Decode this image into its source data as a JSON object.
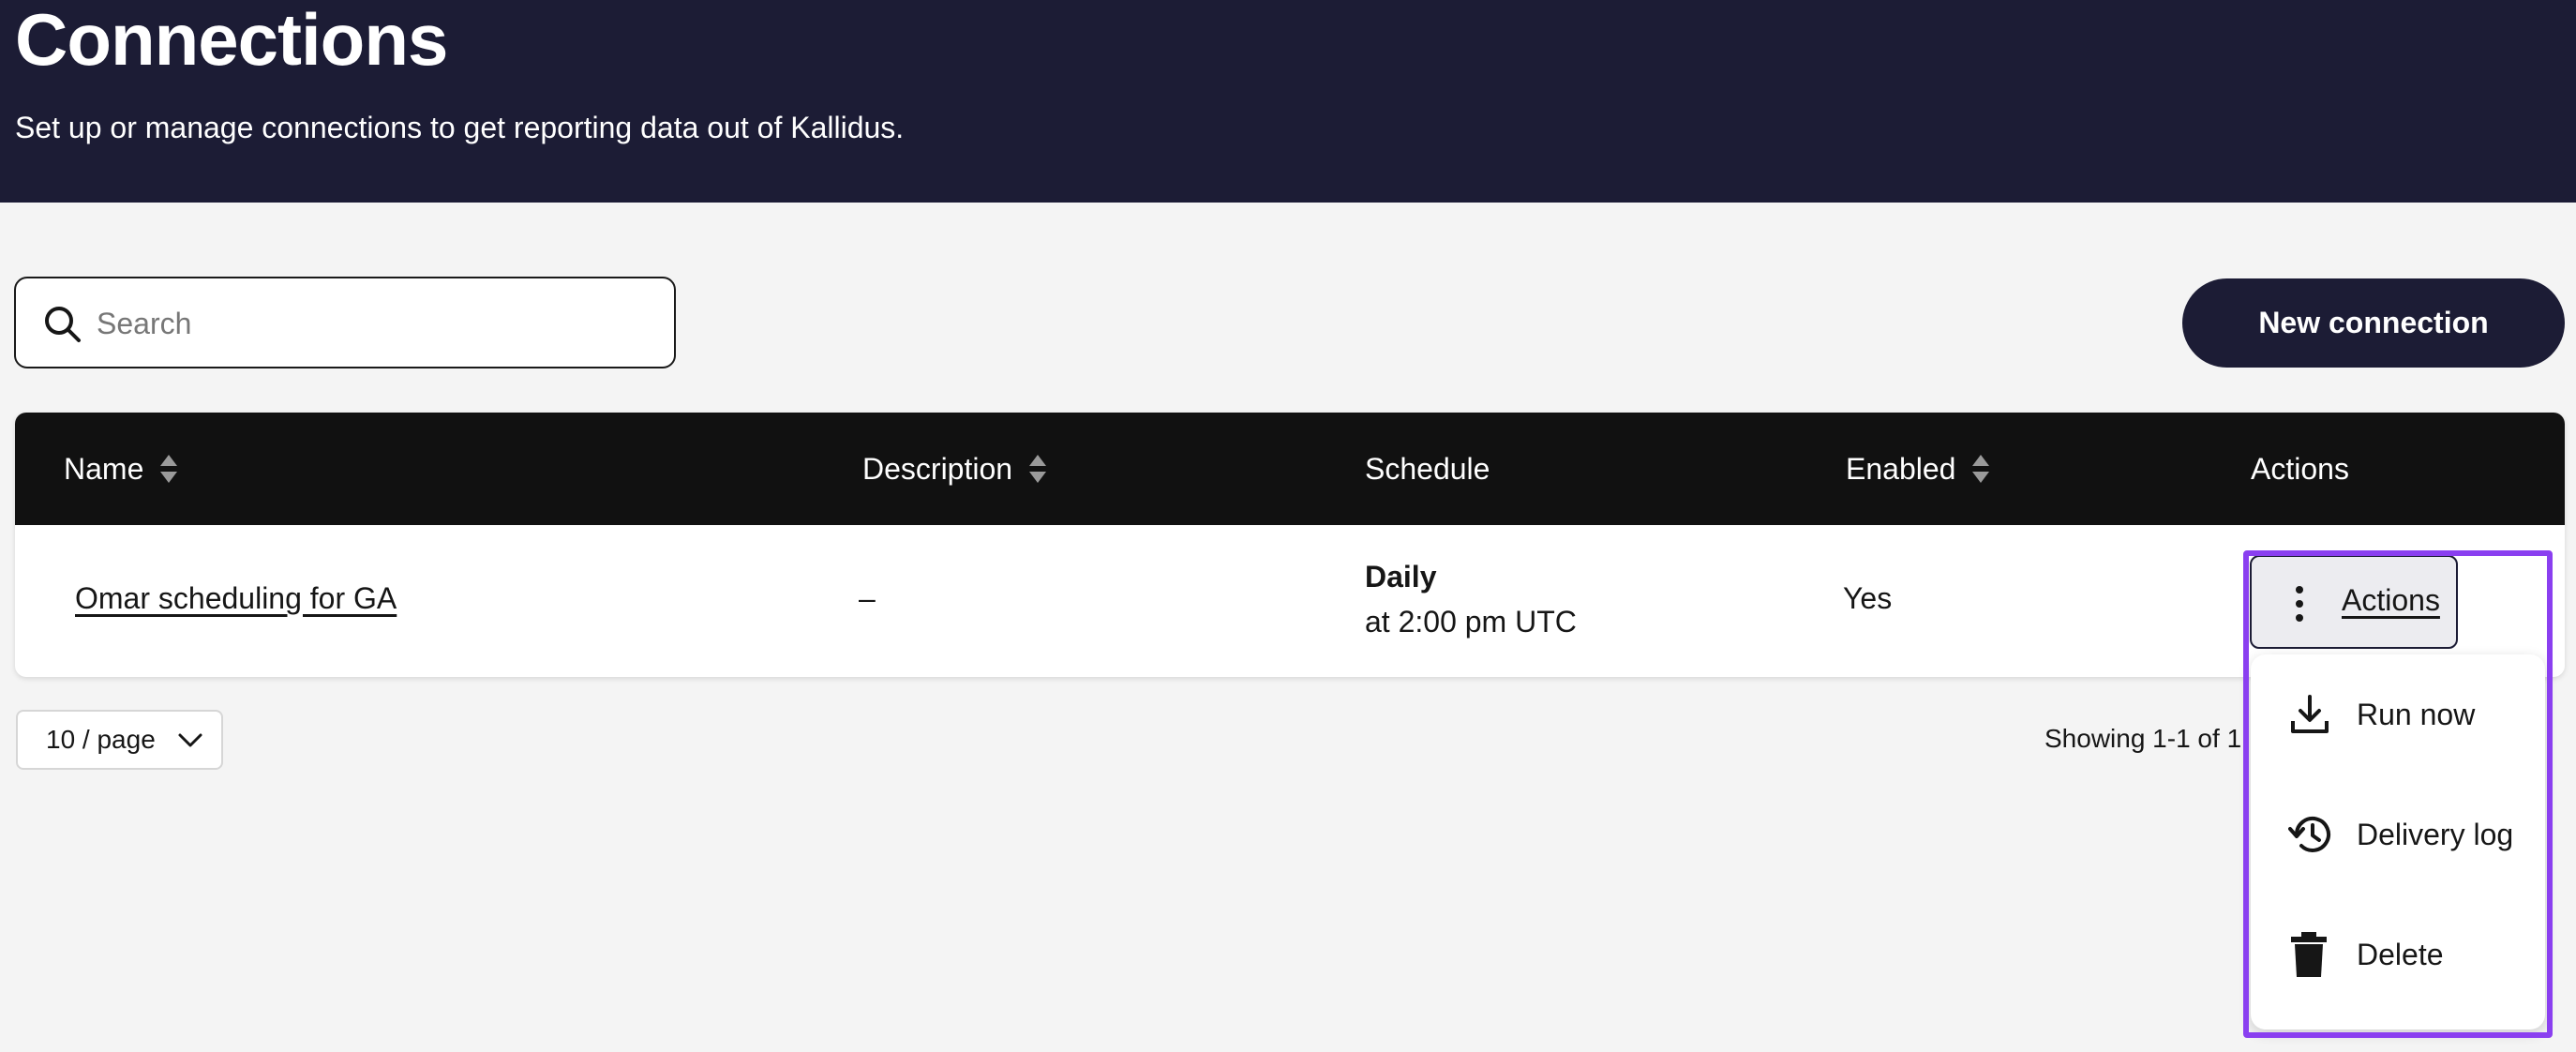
{
  "header": {
    "title": "Connections",
    "subtitle": "Set up or manage connections to get reporting data out of Kallidus."
  },
  "toolbar": {
    "search_placeholder": "Search",
    "search_value": "",
    "new_connection_label": "New connection"
  },
  "table": {
    "columns": [
      {
        "label": "Name",
        "sortable": true
      },
      {
        "label": "Description",
        "sortable": true
      },
      {
        "label": "Schedule",
        "sortable": false
      },
      {
        "label": "Enabled",
        "sortable": true
      },
      {
        "label": "Actions",
        "sortable": false
      }
    ],
    "rows": [
      {
        "name": "Omar scheduling for GA",
        "description": "–",
        "schedule_frequency": "Daily",
        "schedule_time": "at 2:00 pm UTC",
        "enabled": "Yes",
        "actions_label": "Actions"
      }
    ]
  },
  "actions_menu": {
    "items": [
      {
        "label": "Run now",
        "icon": "download-icon"
      },
      {
        "label": "Delivery log",
        "icon": "history-icon"
      },
      {
        "label": "Delete",
        "icon": "trash-icon"
      }
    ]
  },
  "pagination": {
    "page_size": "10 / page",
    "showing": "Showing 1-1 of 1"
  },
  "colors": {
    "header_bg": "#1c1c35",
    "table_header_bg": "#111111",
    "highlight": "#8a3ff0",
    "page_bg": "#f4f4f4"
  }
}
